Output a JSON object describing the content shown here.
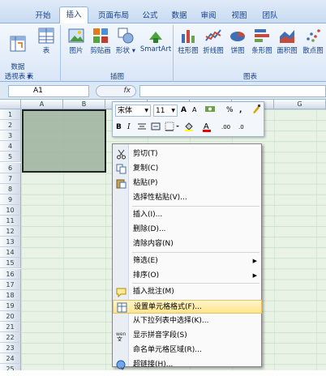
{
  "tabs": [
    "开始",
    "插入",
    "页面布局",
    "公式",
    "数据",
    "审阅",
    "视图",
    "团队"
  ],
  "ribbon": {
    "table_group": {
      "label": "表",
      "buttons": [
        "数据\n透视表 ▾",
        "表"
      ]
    },
    "illus_group": {
      "label": "插图",
      "buttons": [
        "图片",
        "剪贴画",
        "形状 ▾",
        "SmartArt"
      ]
    },
    "chart_group": {
      "label": "图表",
      "buttons": [
        "柱形图",
        "折线图",
        "饼图",
        "条形图",
        "面积图",
        "散点图"
      ]
    }
  },
  "formula_bar": {
    "name_box": "A1",
    "fx": "fx"
  },
  "columns": [
    "A",
    "B",
    "C",
    "D",
    "E",
    "F",
    "G"
  ],
  "rows": [
    "1",
    "2",
    "3",
    "4",
    "5",
    "6",
    "7",
    "8",
    "9",
    "10",
    "11",
    "12",
    "13",
    "14",
    "15",
    "16",
    "17",
    "18",
    "19",
    "20",
    "21",
    "22",
    "23",
    "24",
    "25"
  ],
  "mini_toolbar": {
    "font": "宋体",
    "size": "11",
    "grow": "A",
    "shrink": "A",
    "percent": "%",
    "comma": ","
  },
  "context_menu": [
    {
      "label": "剪切(T)",
      "icon": "scissors-icon"
    },
    {
      "label": "复制(C)",
      "icon": "copy-icon"
    },
    {
      "label": "粘贴(P)",
      "icon": "paste-icon"
    },
    {
      "label": "选择性粘贴(V)...",
      "icon": ""
    },
    {
      "label": "插入(I)...",
      "icon": ""
    },
    {
      "label": "删除(D)...",
      "icon": ""
    },
    {
      "label": "清除内容(N)",
      "icon": ""
    },
    {
      "label": "筛选(E)",
      "icon": "",
      "sub": true
    },
    {
      "label": "排序(O)",
      "icon": "",
      "sub": true
    },
    {
      "label": "插入批注(M)",
      "icon": "comment-icon"
    },
    {
      "label": "设置单元格格式(F)...",
      "icon": "format-cells-icon"
    },
    {
      "label": "从下拉列表中选择(K)...",
      "icon": ""
    },
    {
      "label": "显示拼音字段(S)",
      "icon": "phonetic-icon"
    },
    {
      "label": "命名单元格区域(R)...",
      "icon": ""
    },
    {
      "label": "超链接(H)...",
      "icon": "hyperlink-icon"
    }
  ],
  "colors": {
    "accent": "#15428b",
    "highlight": "#ffe48a"
  }
}
